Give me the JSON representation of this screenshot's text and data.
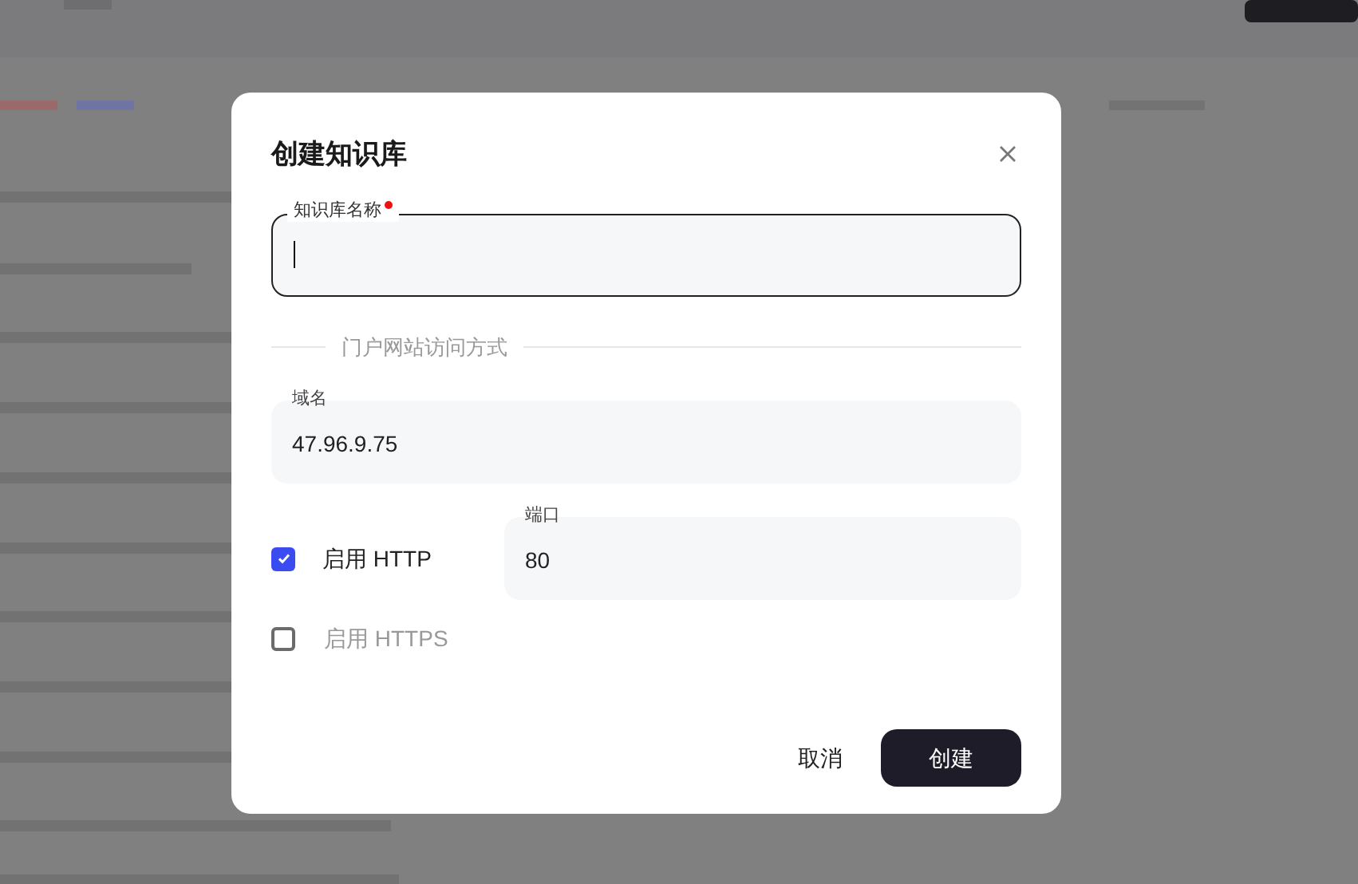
{
  "dialog": {
    "title": "创建知识库",
    "name_field": {
      "label": "知识库名称",
      "required": true,
      "focused": true
    },
    "section_title": "门户网站访问方式",
    "domain_field": {
      "label": "域名",
      "value": "47.96.9.75"
    },
    "http": {
      "label": "启用 HTTP",
      "checked": true
    },
    "port_field": {
      "label": "端口",
      "value": "80"
    },
    "https": {
      "label": "启用 HTTPS",
      "checked": false,
      "disabled": true
    },
    "buttons": [
      {
        "label": "取消",
        "kind": "text"
      },
      {
        "label": "创建",
        "kind": "primary"
      }
    ]
  }
}
